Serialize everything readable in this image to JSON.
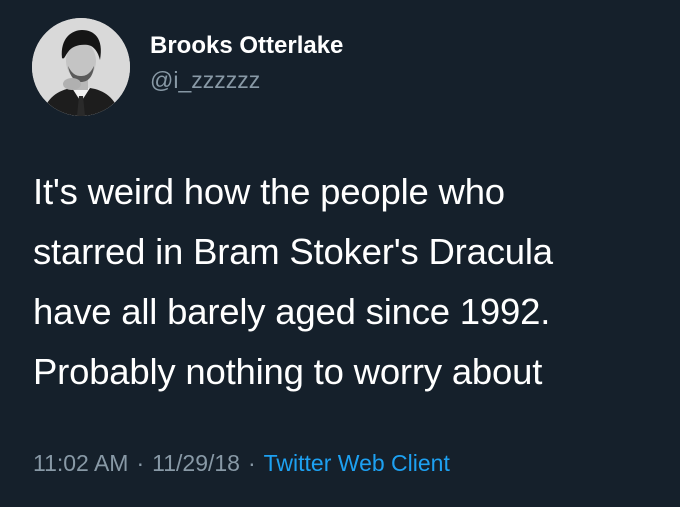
{
  "author": {
    "display_name": "Brooks Otterlake",
    "handle": "@i_zzzzzz",
    "avatar_icon": "profile-photo"
  },
  "tweet": {
    "lines": [
      "It's weird how the people who",
      "starred in Bram Stoker's Dracula",
      "have all barely aged since 1992.",
      "Probably nothing to worry about"
    ]
  },
  "meta": {
    "time": "11:02 AM",
    "separator": "·",
    "date": "11/29/18",
    "source": "Twitter Web Client"
  },
  "colors": {
    "background": "#15202b",
    "text_primary": "#ffffff",
    "text_secondary": "#8899a6",
    "link": "#1da1f2"
  }
}
